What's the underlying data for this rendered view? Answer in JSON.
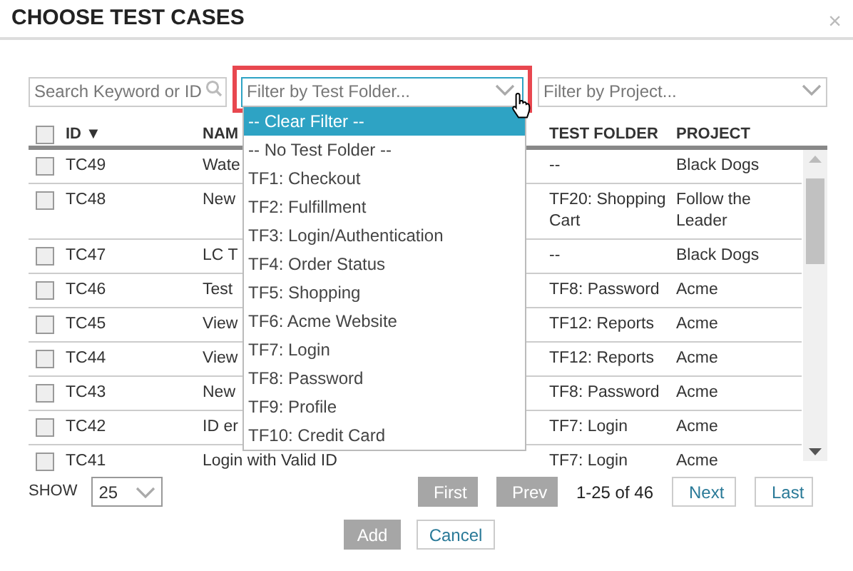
{
  "dialog": {
    "title": "CHOOSE TEST CASES",
    "close": "×"
  },
  "search": {
    "placeholder": "Search Keyword or ID"
  },
  "folder_filter": {
    "placeholder": "Filter by Test Folder...",
    "open": true,
    "highlighted": true,
    "options": [
      {
        "label": "-- Clear Filter --",
        "selected": true
      },
      {
        "label": "-- No Test Folder --",
        "selected": false
      },
      {
        "label": "TF1: Checkout",
        "selected": false
      },
      {
        "label": "TF2: Fulfillment",
        "selected": false
      },
      {
        "label": "TF3: Login/Authentication",
        "selected": false
      },
      {
        "label": "TF4: Order Status",
        "selected": false
      },
      {
        "label": "TF5: Shopping",
        "selected": false
      },
      {
        "label": "TF6: Acme Website",
        "selected": false
      },
      {
        "label": "TF7: Login",
        "selected": false
      },
      {
        "label": "TF8: Password",
        "selected": false
      },
      {
        "label": "TF9: Profile",
        "selected": false
      },
      {
        "label": "TF10: Credit Card",
        "selected": false
      }
    ]
  },
  "project_filter": {
    "placeholder": "Filter by Project..."
  },
  "table": {
    "all_checked": false,
    "columns": [
      {
        "label": "ID",
        "sort_mark": "▼"
      },
      {
        "label": "NAM"
      },
      {
        "label": "TEST FOLDER"
      },
      {
        "label": "PROJECT"
      }
    ],
    "rows": [
      {
        "checked": false,
        "id": "TC49",
        "name": "Wate",
        "folder": "--",
        "project": "Black Dogs"
      },
      {
        "checked": false,
        "id": "TC48",
        "name": "New",
        "folder": "TF20: Shopping Cart",
        "project": "Follow the Leader"
      },
      {
        "checked": false,
        "id": "TC47",
        "name": "LC T",
        "folder": "--",
        "project": "Black Dogs"
      },
      {
        "checked": false,
        "id": "TC46",
        "name": "Test",
        "folder": "TF8: Password",
        "project": "Acme"
      },
      {
        "checked": false,
        "id": "TC45",
        "name": "View",
        "folder": "TF12: Reports",
        "project": "Acme"
      },
      {
        "checked": false,
        "id": "TC44",
        "name": "View",
        "folder": "TF12: Reports",
        "project": "Acme"
      },
      {
        "checked": false,
        "id": "TC43",
        "name": "New",
        "folder": "TF8: Password",
        "project": "Acme"
      },
      {
        "checked": false,
        "id": "TC42",
        "name": "ID er",
        "folder": "TF7: Login",
        "project": "Acme"
      },
      {
        "checked": false,
        "id": "TC41",
        "name": "Login with Valid ID",
        "folder": "TF7: Login",
        "project": "Acme"
      }
    ]
  },
  "pagination": {
    "show_label": "SHOW",
    "page_size": "25",
    "range": "1-25 of 46",
    "buttons": [
      {
        "label": "First",
        "disabled": true
      },
      {
        "label": "Prev",
        "disabled": true
      },
      {
        "label": "Next",
        "disabled": false
      },
      {
        "label": "Last",
        "disabled": false
      }
    ]
  },
  "actions": [
    {
      "label": "Add",
      "disabled": true
    },
    {
      "label": "Cancel",
      "disabled": false
    }
  ]
}
